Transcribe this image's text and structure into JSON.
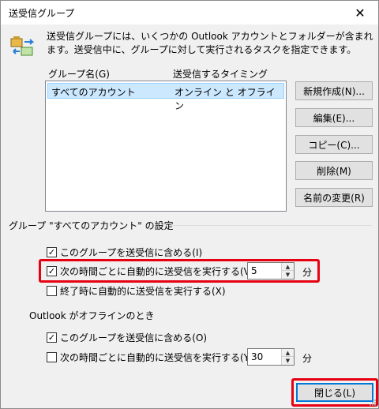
{
  "window": {
    "title": "送受信グループ",
    "close_glyph": "✕"
  },
  "description": "送受信グループには、いくつかの Outlook アカウントとフォルダーが含まれます。送受信中に、グループに対して実行されるタスクを指定できます。",
  "list": {
    "col_name": "グループ名(G)",
    "col_timing": "送受信するタイミング",
    "rows": [
      {
        "name": "すべてのアカウント",
        "timing": "オンライン と オフライン"
      }
    ]
  },
  "buttons": {
    "new": "新規作成(N)...",
    "edit": "編集(E)...",
    "copy": "コピー(C)...",
    "delete": "削除(M)",
    "rename": "名前の変更(R)",
    "close": "閉じる(L)"
  },
  "group_settings": {
    "label": "グループ \"すべてのアカウント\" の設定",
    "online": {
      "include_label": "このグループを送受信に含める(I)",
      "include_checked": true,
      "schedule_label": "次の時間ごとに自動的に送受信を実行する(V)",
      "schedule_checked": true,
      "schedule_value": "5",
      "schedule_unit": "分",
      "on_exit_label": "終了時に自動的に送受信を実行する(X)",
      "on_exit_checked": false
    },
    "offline": {
      "label": "Outlook がオフラインのとき",
      "include_label": "このグループを送受信に含める(O)",
      "include_checked": true,
      "schedule_label": "次の時間ごとに自動的に送受信を実行する(Y)",
      "schedule_checked": false,
      "schedule_value": "30",
      "schedule_unit": "分"
    }
  },
  "colors": {
    "highlight": "#e60012",
    "selection": "#cce8ff",
    "focus": "#0078d7"
  },
  "icons": {
    "app": "send-receive-icon",
    "close": "close-icon",
    "check": "checkmark-icon"
  }
}
